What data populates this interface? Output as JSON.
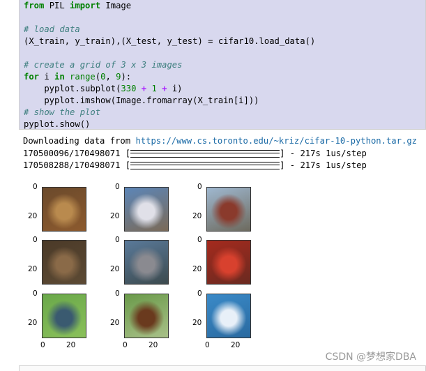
{
  "code": {
    "line0": {
      "kw1": "from",
      "mod": " PIL ",
      "kw2": "import",
      "name": " Image"
    },
    "comment1": "# load data",
    "line_load": "(X_train, y_train),(X_test, y_test) = cifar10.load_data()",
    "comment2": "# create a grid of 3 x 3 images",
    "for_kw": "for",
    "for_var": " i ",
    "in_kw": "in",
    "range_fn": " range",
    "range_args_a": "(",
    "range_n0": "0",
    "range_mid": ", ",
    "range_n9": "9",
    "range_end": "):",
    "subplot_pre": "    pyplot.subplot(",
    "subplot_n330": "330",
    "subplot_plus1": " + ",
    "subplot_n1": "1",
    "subplot_plus2": " + ",
    "subplot_post": "i)",
    "imshow_line": "    pyplot.imshow(Image.fromarray(X_train[i]))",
    "comment3": "# show the plot",
    "show_line": "pyplot.show()"
  },
  "output": {
    "download_prefix": "Downloading data from ",
    "download_url": "https://www.cs.toronto.edu/~kriz/cifar-10-python.tar.gz",
    "progress1_count": "170500096/170498071 [",
    "progress1_suffix": "] - 217s 1us/step",
    "progress2_count": "170508288/170498071 [",
    "progress2_suffix": "] - 217s 1us/step"
  },
  "plot": {
    "ytick_0": "0",
    "ytick_20": "20",
    "xtick_0": "0",
    "xtick_20": "20",
    "images": [
      {
        "name": "frog",
        "colors": [
          "#6b4a2c",
          "#b98a4e",
          "#8c5a2e"
        ]
      },
      {
        "name": "truck",
        "colors": [
          "#5c86b8",
          "#e0e0e8",
          "#7a6a58"
        ]
      },
      {
        "name": "truck-red",
        "colors": [
          "#9fb8d0",
          "#8a3a2c",
          "#6d6a5e"
        ]
      },
      {
        "name": "deer",
        "colors": [
          "#4b3a28",
          "#8a6a48",
          "#5c4a34"
        ]
      },
      {
        "name": "car",
        "colors": [
          "#5a7a9a",
          "#8a8a90",
          "#3c4a4e"
        ]
      },
      {
        "name": "red-car",
        "colors": [
          "#a52a1e",
          "#d8412e",
          "#6a2a20"
        ]
      },
      {
        "name": "bird",
        "colors": [
          "#6aa84a",
          "#3a5a70",
          "#8ac05a"
        ]
      },
      {
        "name": "horse",
        "colors": [
          "#6a9a4a",
          "#6a3a1e",
          "#a8c088"
        ]
      },
      {
        "name": "ship",
        "colors": [
          "#3a8ac8",
          "#e8f0f8",
          "#2a6aa0"
        ]
      }
    ]
  },
  "watermark": "CSDN @梦想家DBA"
}
